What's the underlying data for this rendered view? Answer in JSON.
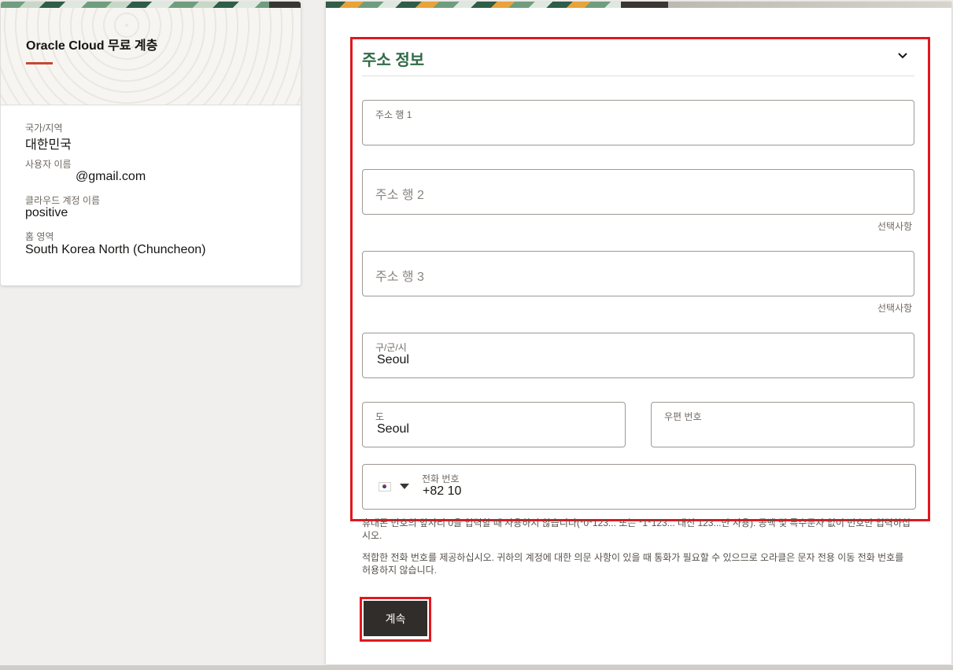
{
  "sidebar": {
    "title": "Oracle Cloud 무료 계층",
    "country_label": "국가/지역",
    "country_value": "대한민국",
    "username_label": "사용자 이름",
    "username_value": "@gmail.com",
    "account_label": "클라우드 계정 이름",
    "account_value": "positive",
    "home_label": "홈 영역",
    "home_value": "South Korea North (Chuncheon)"
  },
  "form": {
    "section_title": "주소 정보",
    "address1_label": "주소 행 1",
    "address2_placeholder": "주소 행 2",
    "address2_optional": "선택사항",
    "address3_placeholder": "주소 행 3",
    "address3_optional": "선택사항",
    "city_label": "구/군/시",
    "city_value": "Seoul",
    "province_label": "도",
    "province_value": "Seoul",
    "postal_label": "우편 번호",
    "phone_label": "전화 번호",
    "phone_value": "+82 10",
    "help_1": "휴대폰 번호의 앞자리 0을 입력할 때 사용하지 않습니다(*0*123... 또는 *1*123... 대신 123...만 사용). 공백 및 특수문자 없이 번호만 입력하십시오.",
    "help_2": "적합한 전화 번호를 제공하십시오. 귀하의 계정에 대한 의문 사항이 있을 때 통화가 필요할 수 있으므로 오라클은 문자 전용 이동 전화 번호를 허용하지 않습니다.",
    "continue_label": "계속"
  },
  "colors": {
    "accent_red": "#c74634",
    "title_green": "#2f6b46",
    "highlight_red": "#e0181f",
    "button_dark": "#312d2a"
  }
}
